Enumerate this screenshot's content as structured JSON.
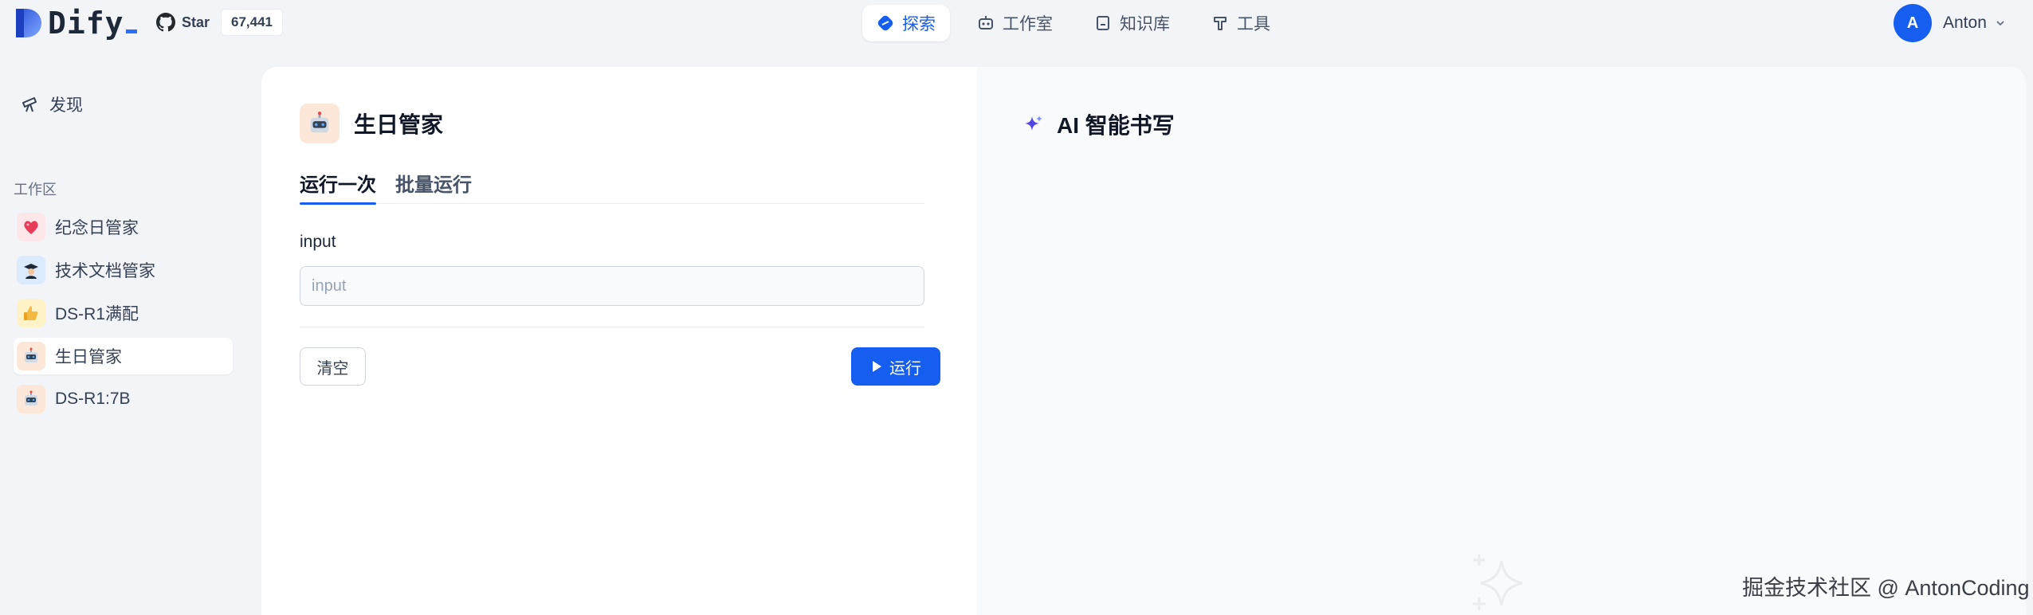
{
  "header": {
    "logo_text": "Dify",
    "github": {
      "star_label": "Star",
      "count": "67,441"
    },
    "nav": [
      {
        "label": "探索",
        "icon": "explore-icon",
        "active": true
      },
      {
        "label": "工作室",
        "icon": "robot-icon",
        "active": false
      },
      {
        "label": "知识库",
        "icon": "book-icon",
        "active": false
      },
      {
        "label": "工具",
        "icon": "hammer-icon",
        "active": false
      }
    ],
    "user": {
      "initial": "A",
      "name": "Anton"
    }
  },
  "sidebar": {
    "discover_label": "发现",
    "workspace_title": "工作区",
    "items": [
      {
        "label": "纪念日管家",
        "icon": "heart-emoji"
      },
      {
        "label": "技术文档管家",
        "icon": "graduate-emoji"
      },
      {
        "label": "DS-R1满配",
        "icon": "thumbs-up-emoji"
      },
      {
        "label": "生日管家",
        "icon": "robot-emoji",
        "active": true
      },
      {
        "label": "DS-R1:7B",
        "icon": "robot-emoji"
      }
    ]
  },
  "app": {
    "title": "生日管家",
    "tabs": [
      {
        "label": "运行一次",
        "active": true
      },
      {
        "label": "批量运行",
        "active": false
      }
    ],
    "field_label": "input",
    "field_placeholder": "input",
    "clear_label": "清空",
    "run_label": "运行"
  },
  "result": {
    "title": "AI 智能书写"
  },
  "watermark": "掘金技术社区 @ AntonCoding",
  "colors": {
    "accent": "#155eef",
    "background": "#f2f4f7"
  }
}
